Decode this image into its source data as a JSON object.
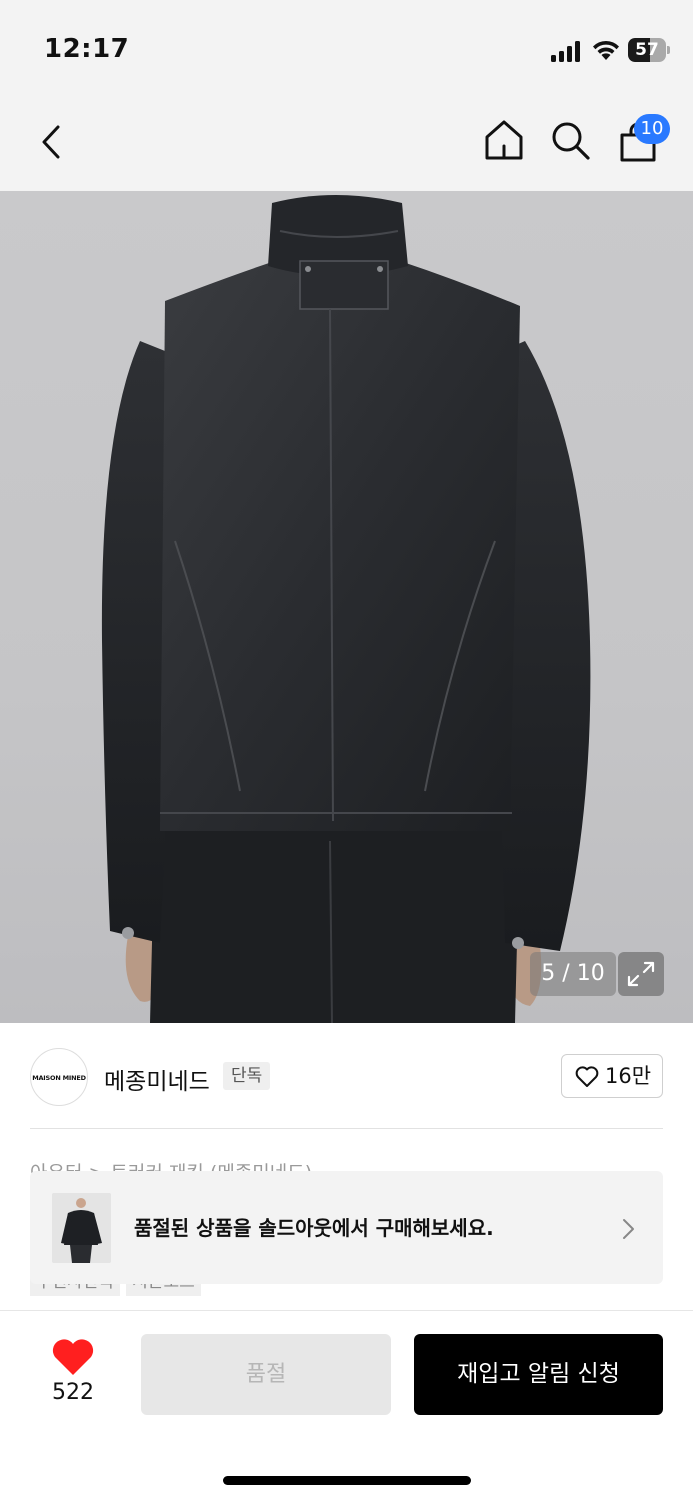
{
  "status_bar": {
    "time": "12:17",
    "battery": "57",
    "battery_level": 0.57
  },
  "header": {
    "cart_badge": "10"
  },
  "gallery": {
    "counter": "5 / 10"
  },
  "brand": {
    "logo_text": "MAISON MINED",
    "name": "메종미네드",
    "exclusive_label": "단독",
    "likes": "16만"
  },
  "breadcrumb": "아우터 > 트러커 재킷 (메종미네드)",
  "tags": [
    "무신사단독",
    "시즌오프"
  ],
  "soldout_banner": {
    "text": "품절된 상품을 솔드아웃에서 구매해보세요."
  },
  "bottom_bar": {
    "wish_count": "522",
    "soldout_label": "품절",
    "restock_label": "재입고 알림 신청"
  },
  "colors": {
    "accent_blue": "#2979ff",
    "heart_red": "#ff1f1f",
    "primary_black": "#000000"
  }
}
